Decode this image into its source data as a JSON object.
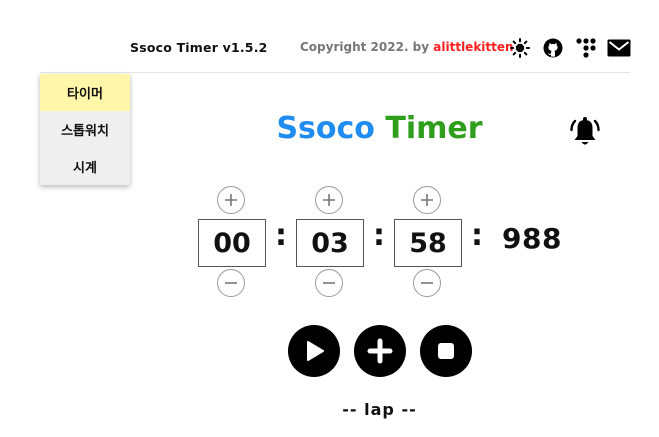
{
  "header": {
    "app_title": "Ssoco Timer v1.5.2",
    "copyright_prefix": "Copyright 2022. by ",
    "author": "alittlekitten",
    "icons": [
      "sun-icon",
      "github-icon",
      "app-grid-icon",
      "mail-icon"
    ]
  },
  "menu": {
    "items": [
      {
        "label": "타이머",
        "active": true
      },
      {
        "label": "스톱워치",
        "active": false
      },
      {
        "label": "시계",
        "active": false
      }
    ]
  },
  "main": {
    "title_part1": "Ssoco",
    "title_part2": "Timer",
    "bell_icon": "bell-ringing-icon"
  },
  "timer": {
    "hours": "00",
    "minutes": "03",
    "seconds": "58",
    "separator": ":",
    "milliseconds": "988"
  },
  "controls": {
    "icons": [
      "play-icon",
      "add-icon",
      "stop-icon"
    ]
  },
  "lap": {
    "label": "-- lap --"
  },
  "colors": {
    "title_blue": "#1e8cf0",
    "title_green": "#2e9e1c",
    "author_red": "#ff1f1f",
    "active_menu_bg": "#fff6a9",
    "menu_bg": "#efefef"
  }
}
